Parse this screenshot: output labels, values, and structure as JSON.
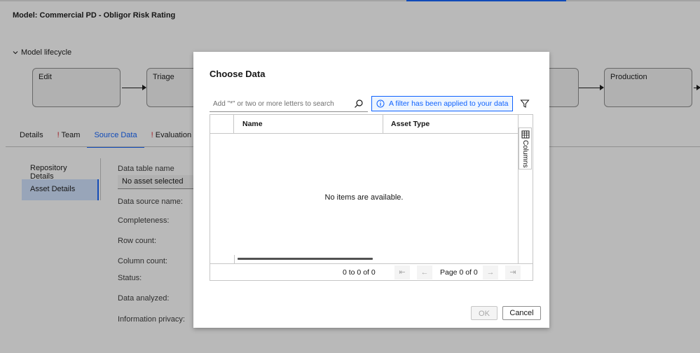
{
  "page": {
    "model_title": "Model: Commercial PD - Obligor Risk Rating",
    "lifecycle_label": "Model lifecycle",
    "stages": [
      "Edit",
      "Triage",
      "",
      "Production"
    ],
    "tabs": {
      "details": "Details",
      "team_marker": "!",
      "team": "Team",
      "source_data": "Source Data",
      "evaluation_marker": "!",
      "evaluation": "Evaluation"
    },
    "sidebar": {
      "repository": "Repository Details",
      "asset": "Asset Details"
    },
    "fields": {
      "data_table_name": "Data table name",
      "asset_value": "No asset selected",
      "data_source_name": "Data source name:",
      "completeness": "Completeness:",
      "row_count": "Row count:",
      "column_count": "Column count:",
      "status": "Status:",
      "data_analyzed": "Data analyzed:",
      "information_privacy": "Information privacy:"
    }
  },
  "modal": {
    "title": "Choose Data",
    "search_placeholder": "Add \"*\" or two or more letters to search",
    "filter_banner": "A filter has been applied to your data",
    "columns": {
      "name": "Name",
      "asset_type": "Asset Type"
    },
    "empty_message": "No items are available.",
    "side_panel_label": "Columns",
    "pagination": {
      "count": "0 to 0 of 0",
      "first": "⇤",
      "prev": "←",
      "page": "Page 0 of 0",
      "next": "→",
      "last": "⇥"
    },
    "ok_label": "OK",
    "cancel_label": "Cancel"
  },
  "colors": {
    "accent": "#0f62fe",
    "warning": "#da1e28",
    "overlay": "rgba(22,22,22,0.30)"
  },
  "icons": [
    "chevron-down-icon",
    "search-icon",
    "info-icon",
    "filter-icon",
    "columns-icon"
  ]
}
